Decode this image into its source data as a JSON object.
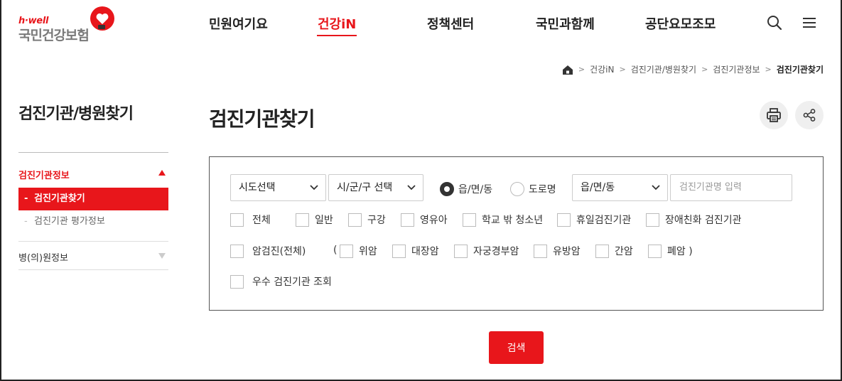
{
  "logo": {
    "top": "h·well",
    "name": "국민건강보험"
  },
  "gnb": [
    {
      "label": "민원여기요"
    },
    {
      "label": "건강iN"
    },
    {
      "label": "정책센터"
    },
    {
      "label": "국민과함께"
    },
    {
      "label": "공단요모조모"
    }
  ],
  "breadcrumb": [
    "건강iN",
    "검진기관/병원찾기",
    "검진기관정보",
    "검진기관찾기"
  ],
  "lnb": {
    "title": "검진기관/병원찾기",
    "section1": "검진기관정보",
    "sub1": "검진기관찾기",
    "sub2": "검진기관 평가정보",
    "section2": "병(의)원정보",
    "dash": "-"
  },
  "page": {
    "title": "검진기관찾기"
  },
  "form": {
    "sido": "시도선택",
    "sigungu": "시/군/구 선택",
    "radio1": "읍/면/동",
    "radio2": "도로명",
    "dong": "읍/면/동",
    "name_placeholder": "검진기관명 입력",
    "cb_row1": [
      "전체",
      "일반",
      "구강",
      "영유아",
      "학교 밖 청소년",
      "휴일검진기관",
      "장애친화 검진기관"
    ],
    "cancer_all": "암검진(전체)",
    "paren_open": "(",
    "cb_row2": [
      "위암",
      "대장암",
      "자궁경부암",
      "유방암",
      "간암",
      "폐암 )"
    ],
    "excellent": "우수 검진기관 조회",
    "search_button": "검색"
  },
  "colors": {
    "accent": "#e8161b",
    "logo_gray": "#7a7a7a"
  }
}
